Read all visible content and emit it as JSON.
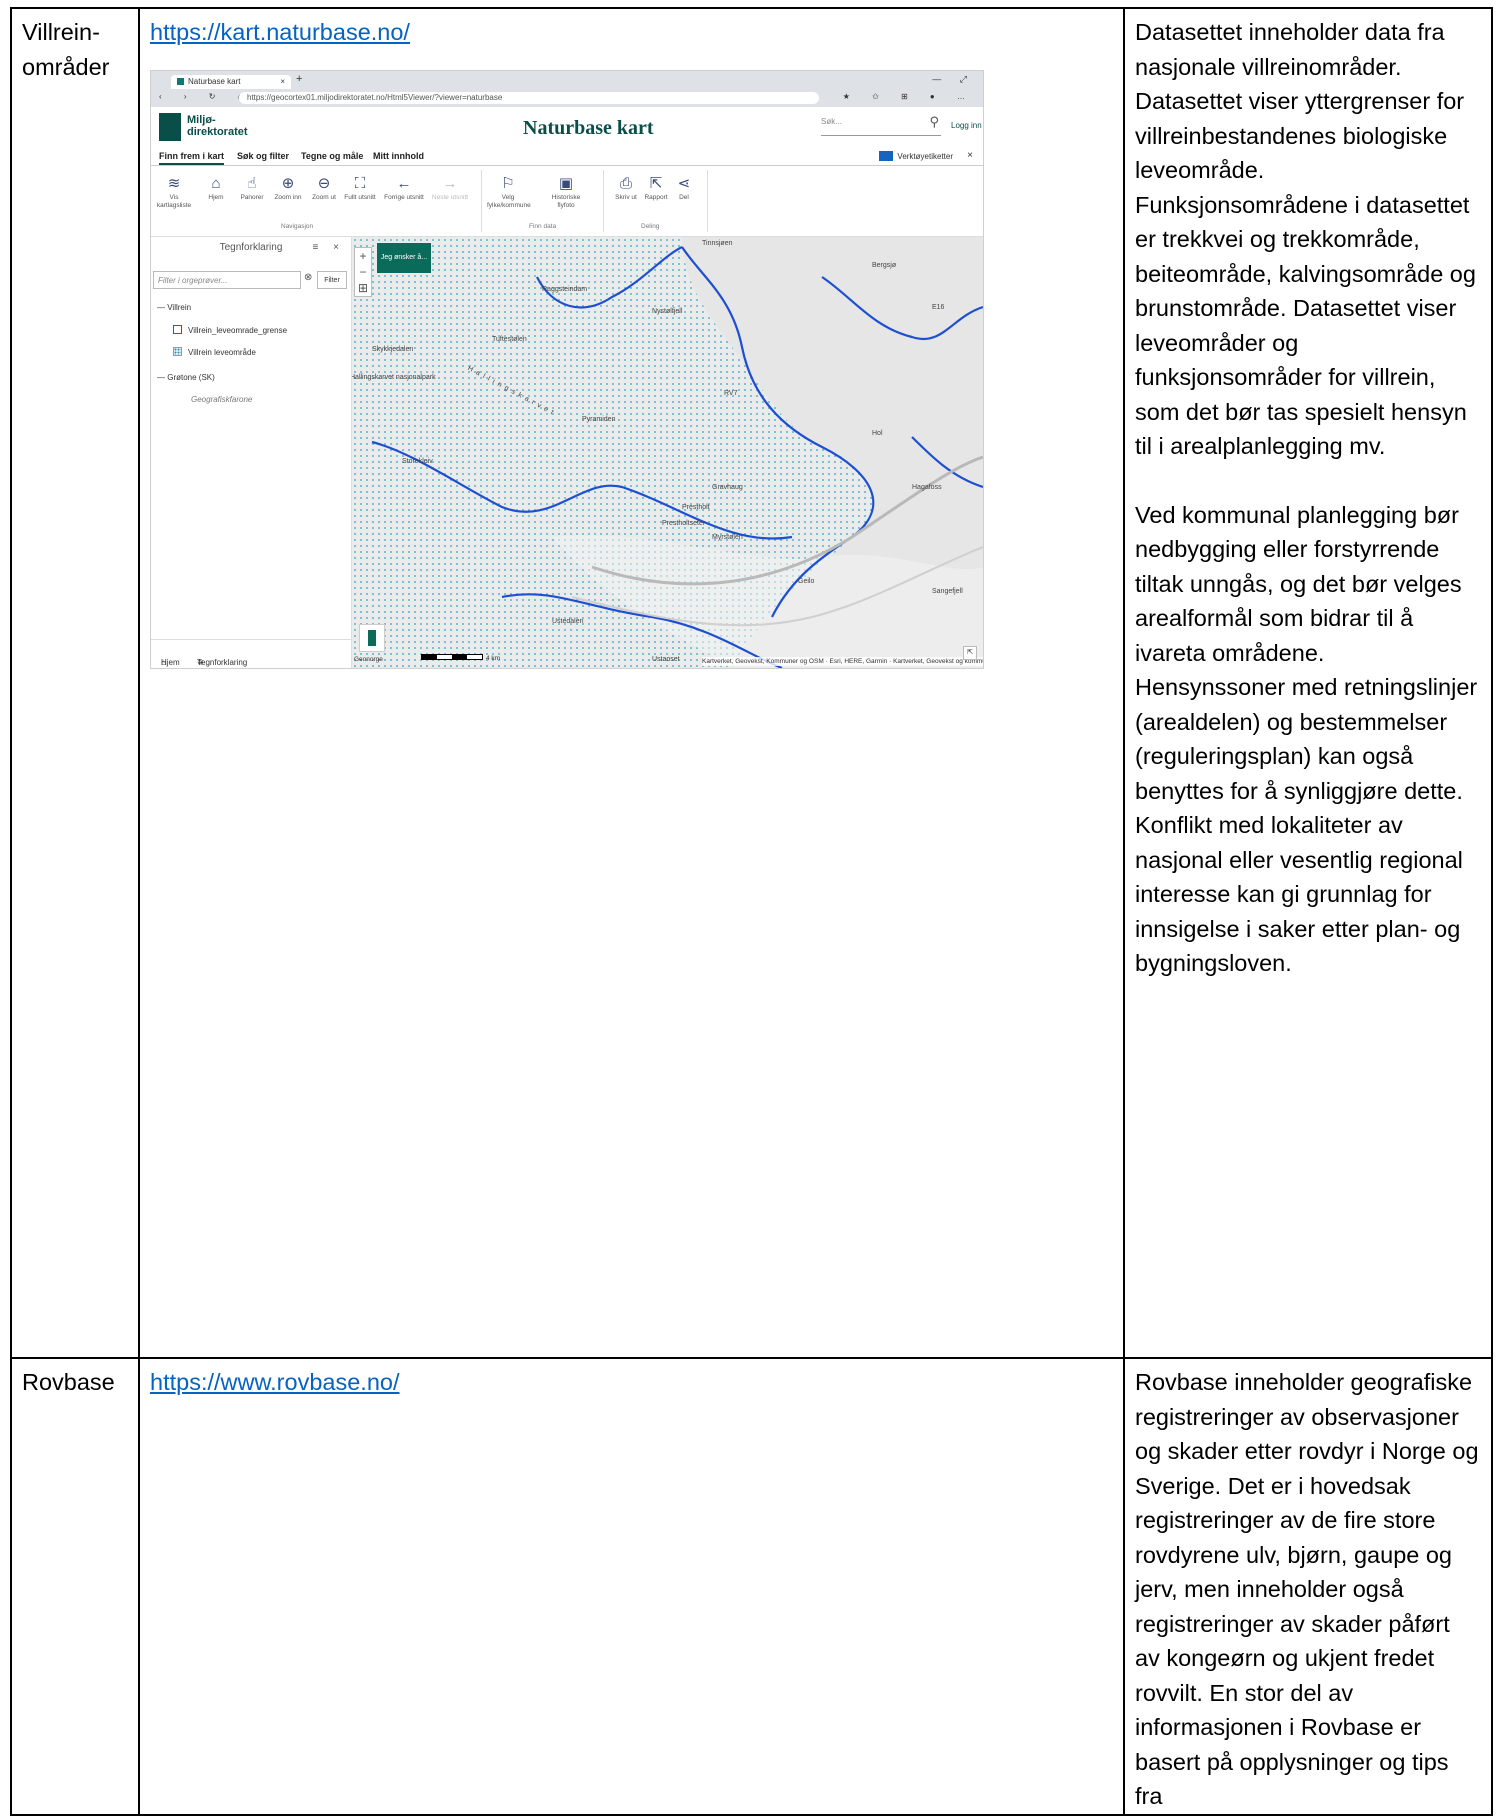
{
  "rows": [
    {
      "name": "Villrein-\nområder",
      "link": "https://kart.naturbase.no/",
      "description": [
        "Datasettet inneholder data fra nasjonale villreinområder. Datasettet viser yttergrenser for villreinbestandenes biologiske leveområde. Funksjonsområdene i datasettet er trekkvei og trekkområde, beiteområde, kalvingsområde og brunstområde. Datasettet viser leveområder og funksjonsområder for villrein, som det bør tas spesielt hensyn til i arealplanlegging mv.",
        "Ved kommunal planlegging bør nedbygging eller forstyrrende tiltak unngås, og det bør velges arealformål som bidrar til å ivareta områdene. Hensynssoner med retningslinjer (arealdelen) og bestemmelser (reguleringsplan) kan også benyttes for å synliggjøre dette. Konflikt med lokaliteter av nasjonal eller vesentlig regional interesse kan gi grunnlag for innsigelse i saker etter plan- og bygningsloven."
      ]
    },
    {
      "name": "Rovbase",
      "link": "https://www.rovbase.no/",
      "description": [
        "Rovbase inneholder geografiske registreringer av observasjoner og skader etter rovdyr i Norge og Sverige. Det er i hovedsak registreringer av de fire store rovdyrene ulv, bjørn, gaupe og jerv, men inneholder også registreringer av skader påført av kongeørn og ukjent fredet rovvilt. En stor del av informasjonen i Rovbase er basert på opplysninger og tips fra"
      ]
    }
  ],
  "screenshot": {
    "browser": {
      "tab_title": "Naturbase kart",
      "tab_close": "×",
      "new_tab": "+",
      "window_controls": "— ⤢",
      "nav": "‹ › ↻ ⌂",
      "url": "https://geocortex01.miljodirektoratet.no/Html5Viewer/?viewer=naturbase",
      "actions": "★ ✩ ⊞ ● …"
    },
    "logo_line1": "Miljø-",
    "logo_line2": "direktoratet",
    "app_title": "Naturbase kart",
    "search_placeholder": "Søk...",
    "search_icon": "⚲",
    "login": "Logg inn",
    "menu": [
      "Finn frem i kart",
      "Søk og filter",
      "Tegne og måle",
      "Mitt innhold"
    ],
    "tools_toggle": "Verktøyetiketter",
    "tools_close": "×",
    "tools": [
      {
        "icon": "≋",
        "label": "Vis kartlagsliste"
      },
      {
        "icon": "⌂",
        "label": "Hjem"
      },
      {
        "icon": "☝",
        "label": "Panorer"
      },
      {
        "icon": "⊕",
        "label": "Zoom inn"
      },
      {
        "icon": "⊖",
        "label": "Zoom ut"
      },
      {
        "icon": "⛶",
        "label": "Fullt utsnitt"
      },
      {
        "icon": "←",
        "label": "Forrige utsnitt"
      },
      {
        "icon": "→",
        "label": "Neste utsnitt"
      },
      {
        "icon": "⚐",
        "label": "Velg fylke/kommune"
      },
      {
        "icon": "▣",
        "label": "Historiske flyfoto"
      },
      {
        "icon": "⎙",
        "label": "Skriv ut"
      },
      {
        "icon": "⇱",
        "label": "Rapport"
      },
      {
        "icon": "⋖",
        "label": "Del"
      }
    ],
    "tool_groups": [
      "Navigasjon",
      "Finn data",
      "Deling"
    ],
    "legend": {
      "title": "Tegnforklaring",
      "controls": "≡ ×",
      "collapse": "‹",
      "filter_placeholder": "Filter i orgeprøver...",
      "filter_clear": "⊗",
      "filter_button": "Filter",
      "groups": [
        {
          "label": "— Villrein",
          "items": [
            "Villrein_leveomrade_grense",
            "Villrein leveområde"
          ]
        },
        {
          "label": "— Grøtone (SK)",
          "items": [
            "Geografiskfarone"
          ]
        }
      ],
      "footer_home": "Hjem",
      "footer_legend": "Tegnforklaring"
    },
    "map": {
      "zoom_in": "+",
      "zoom_out": "−",
      "book": "⊞",
      "action_button": "Jeg ønsker å...",
      "places": [
        "Raggsteindam",
        "Nystølfjell",
        "Tinnsjøen",
        "Hallingskarvet nasjonalpark",
        "Skykkjedalen",
        "Storekleiv",
        "Pyramiden",
        "Prestholt",
        "Gravhaug",
        "Hol",
        "Hagafoss",
        "Geilo",
        "Ustaoset",
        "Sangefjell",
        "Tuftestølen",
        "Bergsjø",
        "Myrstølen",
        "Prestholtseter",
        "Ustedalen",
        "Hallingskarvet"
      ],
      "road_labels": [
        "RV7",
        "E16"
      ],
      "scale": "4 km",
      "attribution": "Kartverket, Geovekst, Kommuner og OSM · Esri, HERE, Garmin · Kartverket, Geovekst og kommuner",
      "footer_logo_text": "Geonorge",
      "expand": "⇱"
    },
    "colors": {
      "brand": "#0a4e49",
      "boundary": "#1565c0",
      "dots": "#5aaecf",
      "link": "#0563c1"
    }
  }
}
